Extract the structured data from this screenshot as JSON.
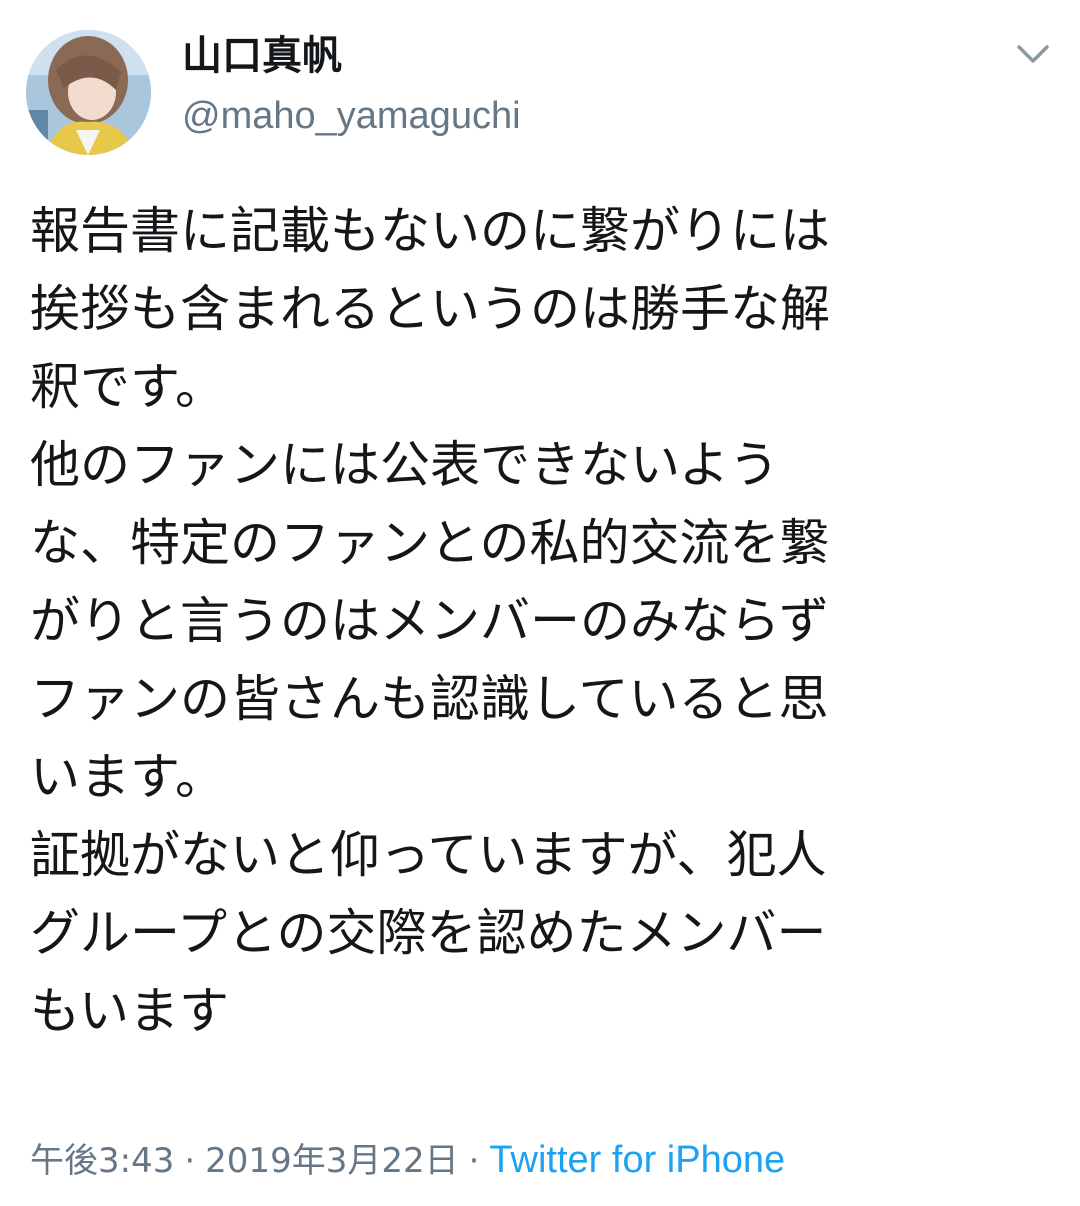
{
  "user": {
    "display_name": "山口真帆",
    "handle": "@maho_yamaguchi"
  },
  "tweet": {
    "lines": [
      "報告書に記載もないのに繋がりには",
      "挨拶も含まれるというのは勝手な解",
      "釈です。",
      "他のファンには公表できないよう",
      "な、特定のファンとの私的交流を繋",
      "がりと言うのはメンバーのみならず",
      "ファンの皆さんも認識していると思",
      "います。",
      "証拠がないと仰っていますが、犯人",
      "グループとの交際を認めたメンバー",
      "もいます"
    ]
  },
  "meta": {
    "time": "午後3:43",
    "separator": "·",
    "date": "2019年3月22日",
    "source": "Twitter for iPhone"
  },
  "icons": {
    "more": "chevron-down-icon",
    "avatar": "profile-photo"
  },
  "colors": {
    "text": "#14171a",
    "secondary": "#657786",
    "link": "#1da1f2"
  }
}
